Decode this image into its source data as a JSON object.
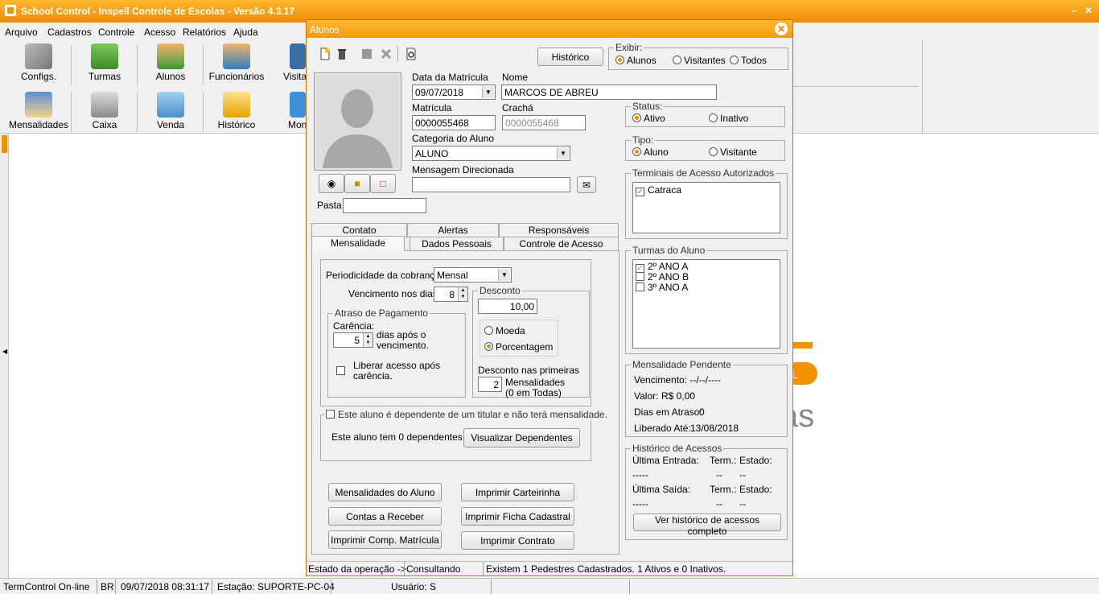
{
  "app": {
    "title": "School Control - Inspell Controle de Escolas - Versão 4.3.17",
    "menu": [
      "Arquivo",
      "Cadastros",
      "Controle",
      "Acesso",
      "Relatórios",
      "Ajuda"
    ],
    "toolbar_row1": [
      "Configs.",
      "Turmas",
      "Alunos",
      "Funcionários",
      "Visita"
    ],
    "toolbar_row2": [
      "Mensalidades",
      "Caixa",
      "Venda",
      "Histórico",
      "Mon"
    ]
  },
  "status": {
    "online": "TermControl On-line",
    "lang": "BR",
    "datetime": "09/07/2018 08:31:17",
    "station": "Estação: SUPORTE-PC-04",
    "user": "Usuário: S"
  },
  "dialog": {
    "title": "Alunos",
    "historico_btn": "Histórico",
    "exibir": {
      "label": "Exibir:",
      "options": [
        "Alunos",
        "Visitantes",
        "Todos"
      ],
      "selected": "Alunos"
    },
    "data_matricula": {
      "label": "Data da Matrícula",
      "value": "09/07/2018"
    },
    "nome": {
      "label": "Nome",
      "value": "MARCOS DE ABREU"
    },
    "matricula": {
      "label": "Matrícula",
      "value": "0000055468"
    },
    "cracha": {
      "label": "Crachá",
      "value": "0000055468"
    },
    "categoria": {
      "label": "Categoria do Aluno",
      "value": "ALUNO"
    },
    "mensagem": {
      "label": "Mensagem Direcionada",
      "value": ""
    },
    "pasta": {
      "label": "Pasta",
      "value": ""
    },
    "status_group": {
      "label": "Status:",
      "options": [
        "Ativo",
        "Inativo"
      ],
      "selected": "Ativo"
    },
    "tipo_group": {
      "label": "Tipo:",
      "options": [
        "Aluno",
        "Visitante"
      ],
      "selected": "Aluno"
    },
    "terminais": {
      "label": "Terminais de Acesso Autorizados",
      "items": [
        {
          "label": "Catraca",
          "checked": true
        }
      ]
    },
    "turmas": {
      "label": "Turmas do Aluno",
      "items": [
        {
          "label": "2º ANO A",
          "checked": true
        },
        {
          "label": "2º ANO B",
          "checked": false
        },
        {
          "label": "3º ANO A",
          "checked": false
        }
      ]
    },
    "tabs_row1": [
      "Contato",
      "Alertas",
      "Responsáveis"
    ],
    "tabs_row2": [
      "Mensalidade",
      "Dados Pessoais",
      "Controle de Acesso"
    ],
    "active_tab": "Mensalidade",
    "mensalidade": {
      "periodicidade_label": "Periodicidade da cobrança:",
      "periodicidade_value": "Mensal",
      "vencimento_label": "Vencimento nos dias:",
      "vencimento_value": "8",
      "atraso_label": "Atraso de Pagamento",
      "carencia_label": "Carência:",
      "carencia_value": "5",
      "dias_apos": "dias após o",
      "vencimento_txt": "vencimento.",
      "liberar_line1": "Liberar acesso após",
      "liberar_line2": "carência.",
      "desconto_label": "Desconto",
      "desconto_value": "10,00",
      "moeda": "Moeda",
      "porcentagem": "Porcentagem",
      "desconto_selected": "Porcentagem",
      "desconto_primeiras": "Desconto nas primeiras",
      "primeiras_value": "2",
      "mensalidades_txt": "Mensalidades",
      "em_todas": "(0 em Todas)",
      "dependente_chk": "Este aluno é dependente de um titular e não terá mensalidade.",
      "dependentes_txt": "Este aluno tem 0 dependentes.",
      "visualizar_btn": "Visualizar Dependentes"
    },
    "action_buttons": [
      "Mensalidades do Aluno",
      "Imprimir Carteirinha",
      "Contas a Receber",
      "Imprimir Ficha Cadastral",
      "Imprimir Comp. Matrícula",
      "Imprimir Contrato"
    ],
    "pendente": {
      "label": "Mensalidade Pendente",
      "vencimento": "Vencimento:   --/--/----",
      "valor_label": "Valor:",
      "valor": "R$ 0,00",
      "dias_label": "Dias em Atraso:",
      "dias": "0",
      "liberado_label": "Liberado Até:",
      "liberado": "13/08/2018"
    },
    "hist_acessos": {
      "label": "Histórico de Acessos",
      "ultima_entrada": "Última Entrada:",
      "ultima_saida": "Última Saída:",
      "term": "Term.:",
      "estado": "Estado:",
      "dash5": "-----",
      "dash2": "--",
      "btn": "Ver histórico de acessos completo"
    },
    "statusbar": {
      "estado": "Estado da operação ->",
      "consultando": "Consultando",
      "existem": "Existem 1 Pedestres Cadastrados. 1 Ativos e 0 Inativos."
    }
  },
  "colors": {
    "accent": "#f39200",
    "window_bg": "#f0f0f0"
  }
}
